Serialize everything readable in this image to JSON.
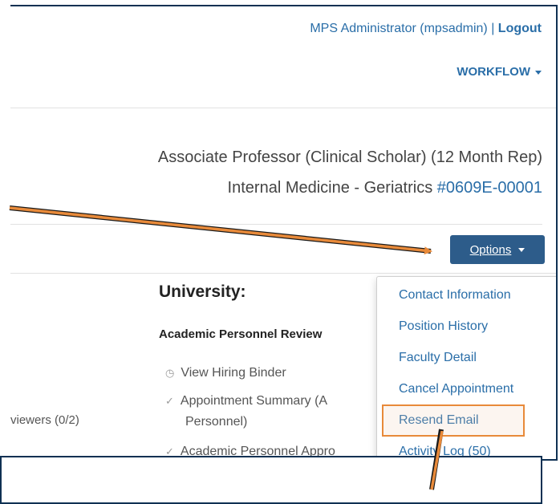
{
  "header": {
    "user_name": "MPS Administrator (mpsadmin)",
    "separator": "|",
    "logout_label": "Logout",
    "workflow_label": "WORKFLOW"
  },
  "position": {
    "title": "Associate Professor (Clinical Scholar) (12 Month Rep)",
    "department": "Internal Medicine - Geriatrics",
    "number": "#0609E-00001"
  },
  "options_label": "Options",
  "options_menu": [
    "Contact Information",
    "Position History",
    "Faculty Detail",
    "Cancel Appointment",
    "Resend Email",
    "Activity Log (50)"
  ],
  "content": {
    "university_heading": "University:",
    "review_heading": "Academic Personnel Review",
    "steps": [
      "View Hiring Binder",
      "Appointment Summary (A",
      "Personnel)",
      "Academic Personnel Appro"
    ],
    "reviewers": "viewers  (0/2)"
  },
  "colors": {
    "link": "#2a6ea8",
    "button": "#2d5c8a",
    "annotation": "#e88a3a",
    "frame": "#0f3153"
  }
}
